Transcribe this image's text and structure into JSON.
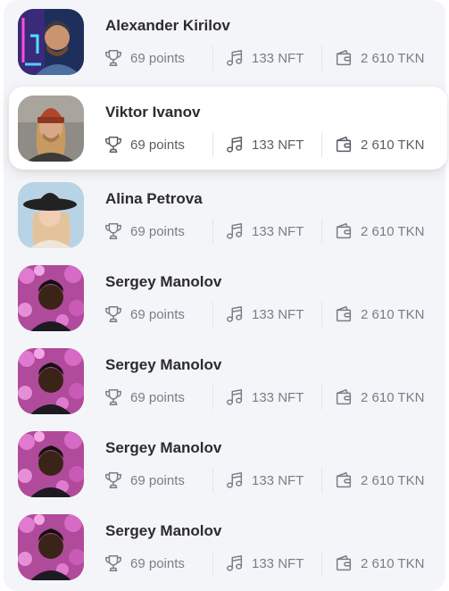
{
  "users": [
    {
      "name": "Alexander Kirilov",
      "points": "69 points",
      "nft": "133 NFT",
      "tokens": "2 610 TKN",
      "avatar": "neon-man"
    },
    {
      "name": "Viktor Ivanov",
      "points": "69 points",
      "nft": "133 NFT",
      "tokens": "2 610 TKN",
      "avatar": "beanie-man",
      "active": true
    },
    {
      "name": "Alina Petrova",
      "points": "69 points",
      "nft": "133 NFT",
      "tokens": "2 610 TKN",
      "avatar": "hat-woman"
    },
    {
      "name": "Sergey Manolov",
      "points": "69 points",
      "nft": "133 NFT",
      "tokens": "2 610 TKN",
      "avatar": "flowers-man"
    },
    {
      "name": "Sergey Manolov",
      "points": "69 points",
      "nft": "133 NFT",
      "tokens": "2 610 TKN",
      "avatar": "flowers-man"
    },
    {
      "name": "Sergey Manolov",
      "points": "69 points",
      "nft": "133 NFT",
      "tokens": "2 610 TKN",
      "avatar": "flowers-man"
    },
    {
      "name": "Sergey Manolov",
      "points": "69 points",
      "nft": "133 NFT",
      "tokens": "2 610 TKN",
      "avatar": "flowers-man"
    }
  ],
  "icons": {
    "points": "trophy-icon",
    "nft": "music-note-icon",
    "tokens": "wallet-icon"
  },
  "colors": {
    "panel": "#f4f5f8",
    "text": "#2b2b30",
    "muted": "#7a7d86",
    "accent_row": "#ffffff"
  }
}
